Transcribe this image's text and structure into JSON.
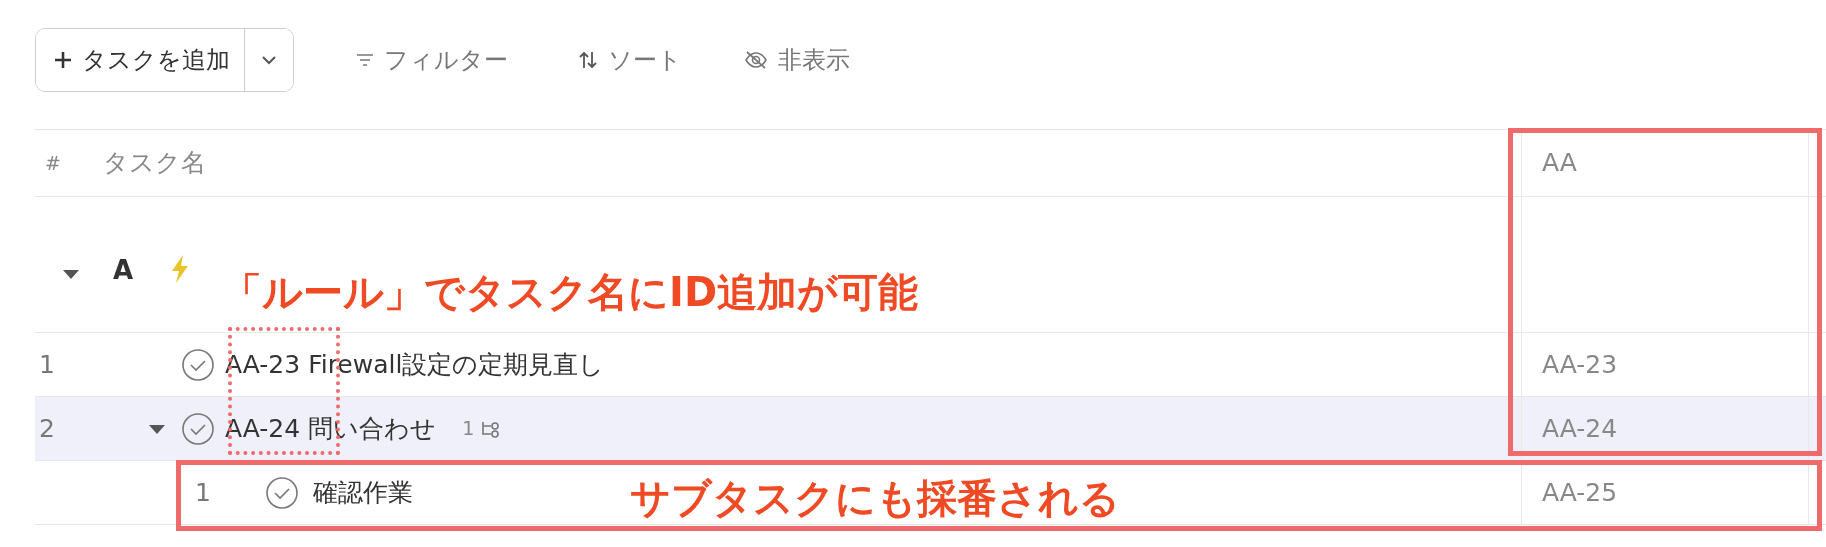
{
  "toolbar": {
    "add_button": {
      "label": "タスクを追加"
    },
    "actions": [
      {
        "kind": "filter",
        "label": "フィルター"
      },
      {
        "kind": "sort",
        "label": "ソート"
      },
      {
        "kind": "hide",
        "label": "非表示"
      }
    ]
  },
  "table": {
    "columns": [
      "#",
      "タスク名",
      "AA"
    ],
    "groups": [
      {
        "name": "A",
        "expanded": true,
        "rows": [
          {
            "index": "1",
            "name": "AA-23 Firewall設定の定期見直し",
            "aa": "AA-23",
            "highlighted": false
          },
          {
            "index": "2",
            "name": "AA-24 問い合わせ",
            "aa": "AA-24",
            "highlighted": true,
            "expanded": true,
            "subtask_count": "1",
            "children": [
              {
                "index": "1",
                "name": "確認作業",
                "aa": "AA-25",
                "highlighted": false
              }
            ]
          }
        ]
      }
    ]
  },
  "annotations": [
    {
      "text": "「ルール」でタスク名にID追加が可能"
    },
    {
      "text": "サブタスクにも採番される"
    }
  ]
}
